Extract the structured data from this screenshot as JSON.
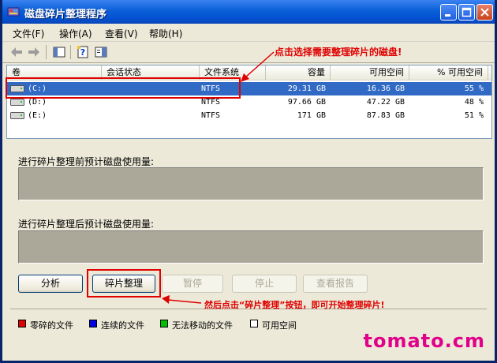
{
  "window": {
    "title": "磁盘碎片整理程序",
    "caption_buttons": [
      "minimize-icon",
      "maximize-icon",
      "close-icon"
    ]
  },
  "menu": [
    "文件(F)",
    "操作(A)",
    "查看(V)",
    "帮助(H)"
  ],
  "toolbar": [
    "back-arrow-icon",
    "forward-arrow-icon",
    "view-icon",
    "help-icon",
    "properties-icon"
  ],
  "list": {
    "columns": [
      "卷",
      "会话状态",
      "文件系统",
      "容量",
      "可用空间",
      "% 可用空间"
    ],
    "rows": [
      {
        "volume": "(C:)",
        "status": "",
        "fs": "NTFS",
        "capacity": "29.31 GB",
        "free": "16.36 GB",
        "pct": "55 %",
        "selected": true
      },
      {
        "volume": "(D:)",
        "status": "",
        "fs": "NTFS",
        "capacity": "97.66 GB",
        "free": "47.22 GB",
        "pct": "48 %",
        "selected": false
      },
      {
        "volume": "(E:)",
        "status": "",
        "fs": "NTFS",
        "capacity": "171 GB",
        "free": "87.83 GB",
        "pct": "51 %",
        "selected": false
      }
    ]
  },
  "sections": {
    "before_label": "进行碎片整理前预计磁盘使用量:",
    "after_label": "进行碎片整理后预计磁盘使用量:"
  },
  "buttons": {
    "analyze": "分析",
    "defrag": "碎片整理",
    "pause": "暂停",
    "stop": "停止",
    "report": "查看报告"
  },
  "legend": [
    {
      "label": "零碎的文件",
      "color": "#e00000"
    },
    {
      "label": "连续的文件",
      "color": "#0000e0"
    },
    {
      "label": "无法移动的文件",
      "color": "#00c000"
    },
    {
      "label": "可用空间",
      "color": "#ffffff"
    }
  ],
  "annotations": {
    "select_disk": "点击选择需要整理碎片的磁盘!",
    "click_defrag": "然后点击“碎片整理”按钮，即可开始整理碎片!",
    "color": "#e00000"
  },
  "watermark": "tomato.cm"
}
